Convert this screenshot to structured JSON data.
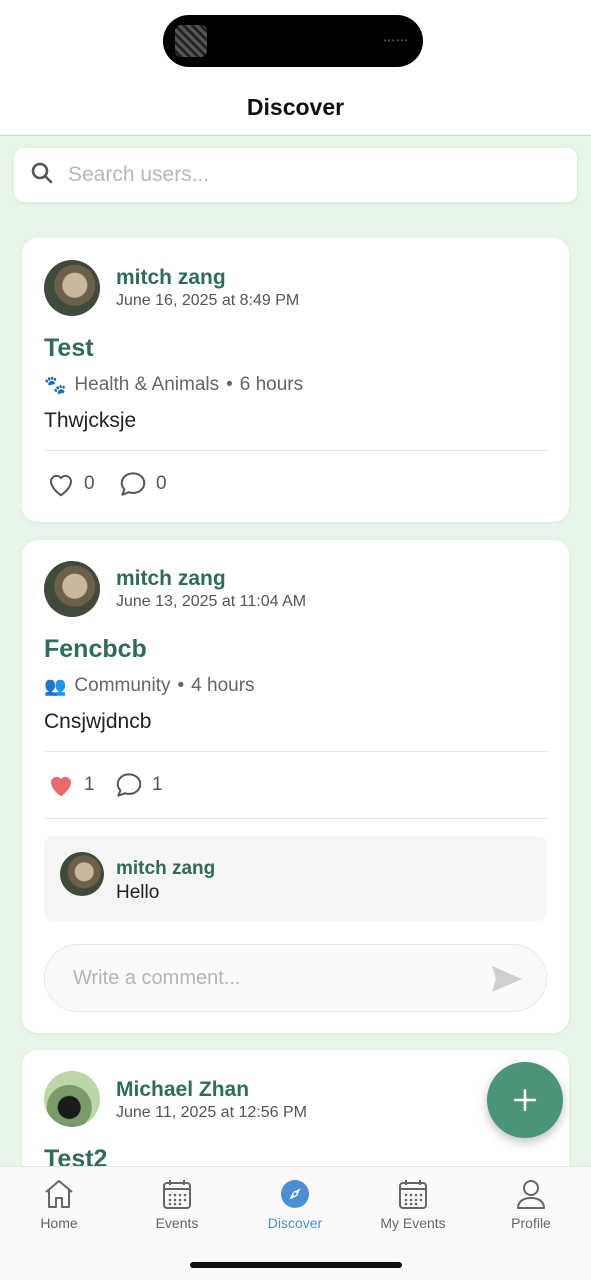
{
  "header": {
    "title": "Discover"
  },
  "search": {
    "placeholder": "Search users..."
  },
  "posts": [
    {
      "user": "mitch zang",
      "timestamp": "June 16, 2025 at 8:49 PM",
      "title": "Test",
      "category_icon": "paw-icon",
      "category": "Health & Animals",
      "duration": "6 hours",
      "body": "Thwjcksje",
      "likes": "0",
      "liked": false,
      "comments": "0"
    },
    {
      "user": "mitch zang",
      "timestamp": "June 13, 2025 at 11:04 AM",
      "title": "Fencbcb",
      "category_icon": "people-icon",
      "category": "Community",
      "duration": "4 hours",
      "body": "Cnsjwjdncb",
      "likes": "1",
      "liked": true,
      "comments": "1",
      "comment_list": [
        {
          "user": "mitch zang",
          "text": "Hello"
        }
      ],
      "comment_placeholder": "Write a comment..."
    },
    {
      "user": "Michael Zhan",
      "timestamp": "June 11, 2025 at 12:56 PM",
      "title": "Test2"
    }
  ],
  "tabs": [
    {
      "label": "Home",
      "icon": "home-icon"
    },
    {
      "label": "Events",
      "icon": "calendar-icon"
    },
    {
      "label": "Discover",
      "icon": "compass-icon",
      "active": true
    },
    {
      "label": "My Events",
      "icon": "calendar-icon"
    },
    {
      "label": "Profile",
      "icon": "person-icon"
    }
  ],
  "colors": {
    "accent_green": "#2f6e56",
    "fab": "#4a9478",
    "active_tab": "#4a8fd6",
    "like": "#e86a6a",
    "background": "#e6f5e8"
  }
}
